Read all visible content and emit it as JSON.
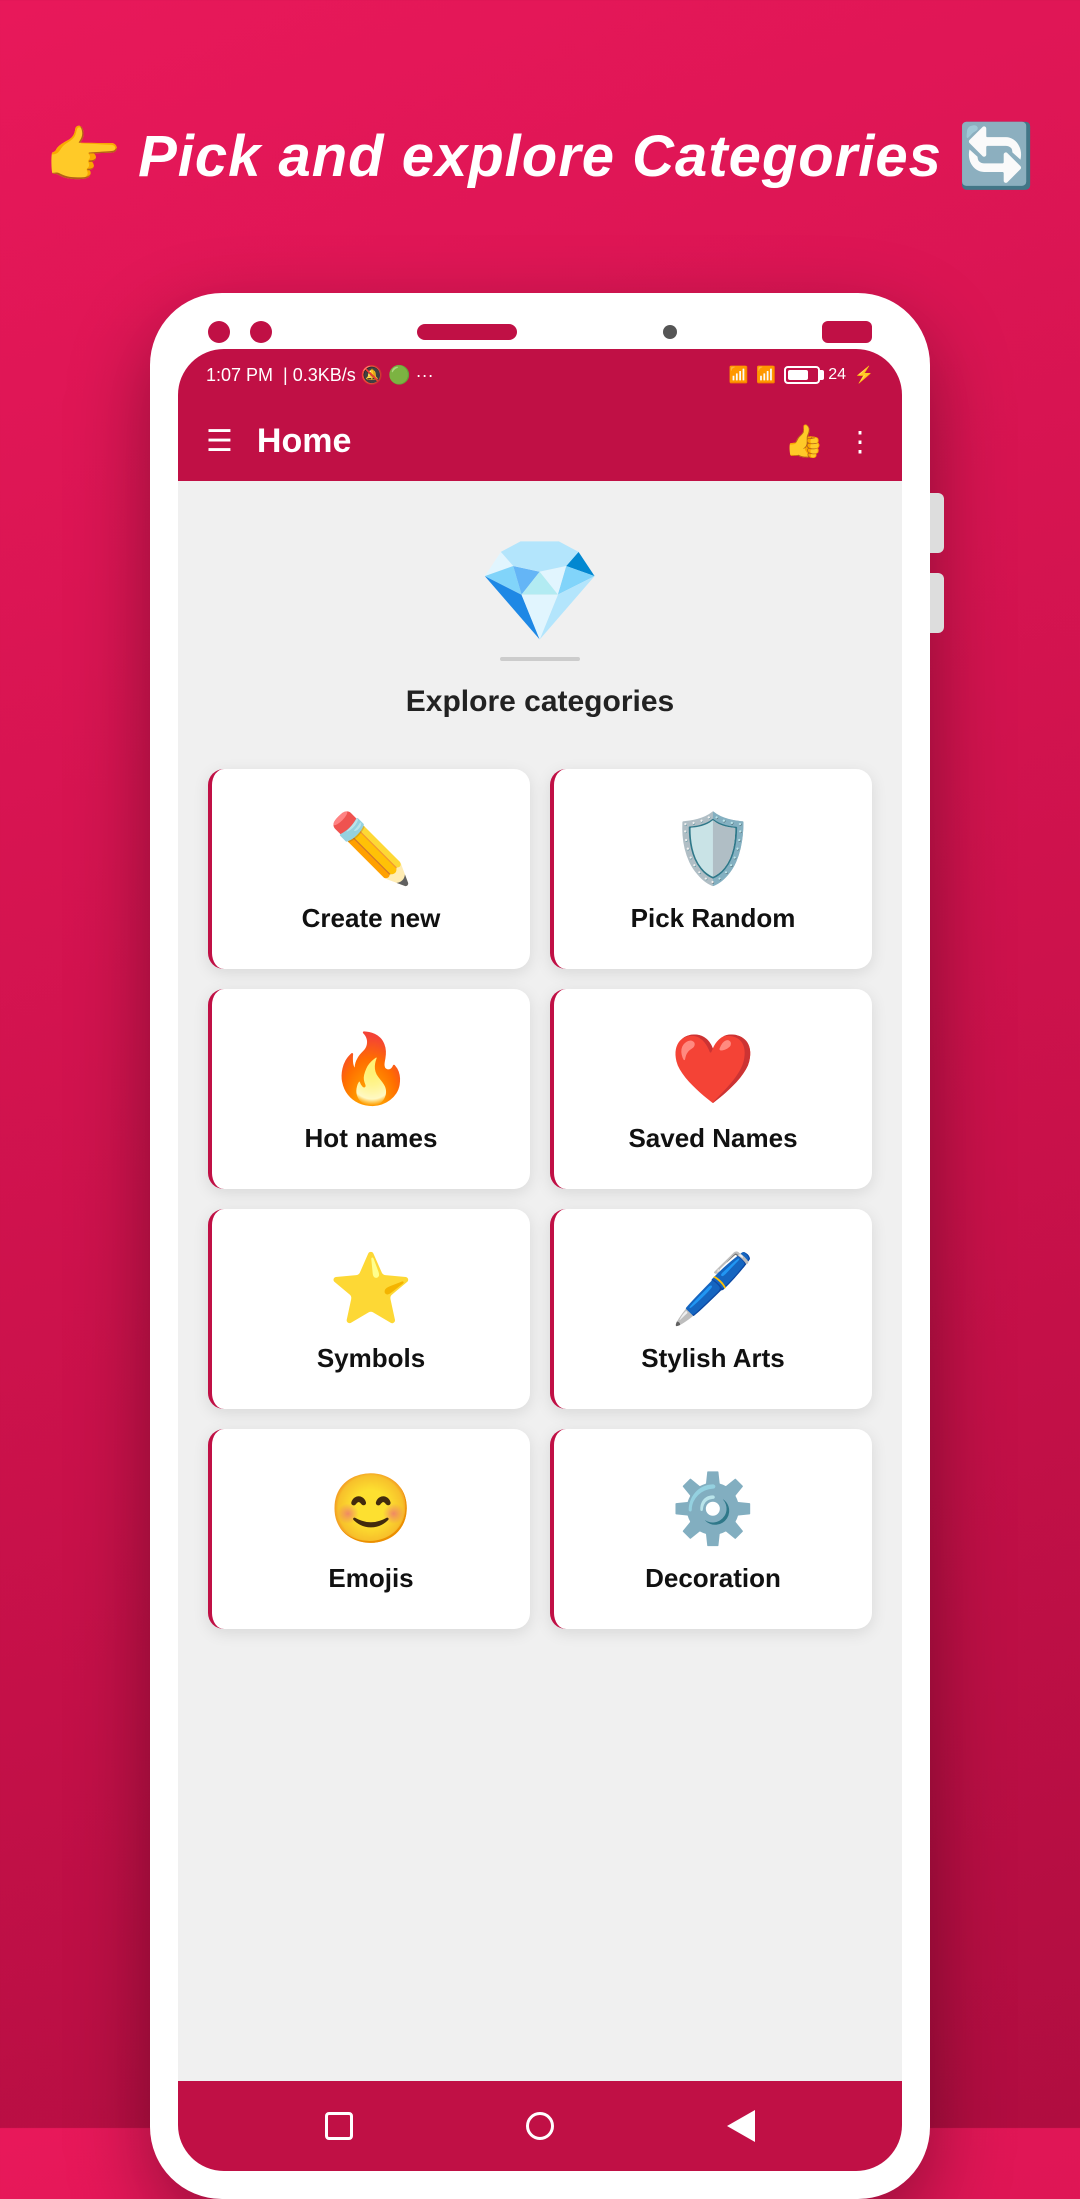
{
  "heading": {
    "emoji": "👉",
    "text": "Pick and explore Categories",
    "icon": "🔄"
  },
  "status_bar": {
    "time": "1:07 PM",
    "speed": "0.3KB/s",
    "battery": "24"
  },
  "app_bar": {
    "title": "Home"
  },
  "explore": {
    "title": "Explore categories"
  },
  "categories": [
    {
      "id": "create-new",
      "label": "Create new",
      "icon": "✏️"
    },
    {
      "id": "pick-random",
      "label": "Pick Random",
      "icon": "🛡️"
    },
    {
      "id": "hot-names",
      "label": "Hot names",
      "icon": "🔥"
    },
    {
      "id": "saved-names",
      "label": "Saved Names",
      "icon": "❤️"
    },
    {
      "id": "symbols",
      "label": "Symbols",
      "icon": "⭐"
    },
    {
      "id": "stylish-arts",
      "label": "Stylish Arts",
      "icon": "🖊️"
    },
    {
      "id": "emojis",
      "label": "Emojis",
      "icon": "😊"
    },
    {
      "id": "decoration",
      "label": "Decoration",
      "icon": "⚙️"
    }
  ],
  "bottom_nav": {
    "square": "■",
    "circle": "●",
    "back": "◀"
  }
}
